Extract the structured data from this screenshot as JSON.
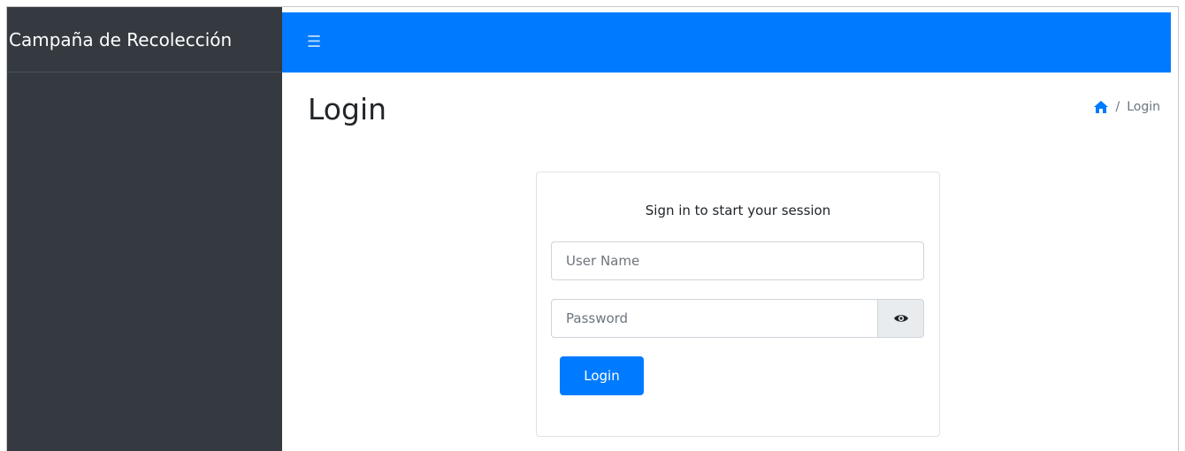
{
  "sidebar": {
    "brand": "Campaña de Recolección"
  },
  "topbar": {
    "menu_icon": "hamburger-icon"
  },
  "header": {
    "title": "Login",
    "breadcrumb": {
      "home_icon": "home-icon",
      "separator": "/",
      "current": "Login"
    }
  },
  "login": {
    "message": "Sign in to start your session",
    "username_placeholder": "User Name",
    "password_placeholder": "Password",
    "toggle_icon": "eye-icon",
    "button_label": "Login"
  },
  "colors": {
    "primary": "#007bff",
    "sidebar": "#343a40"
  }
}
